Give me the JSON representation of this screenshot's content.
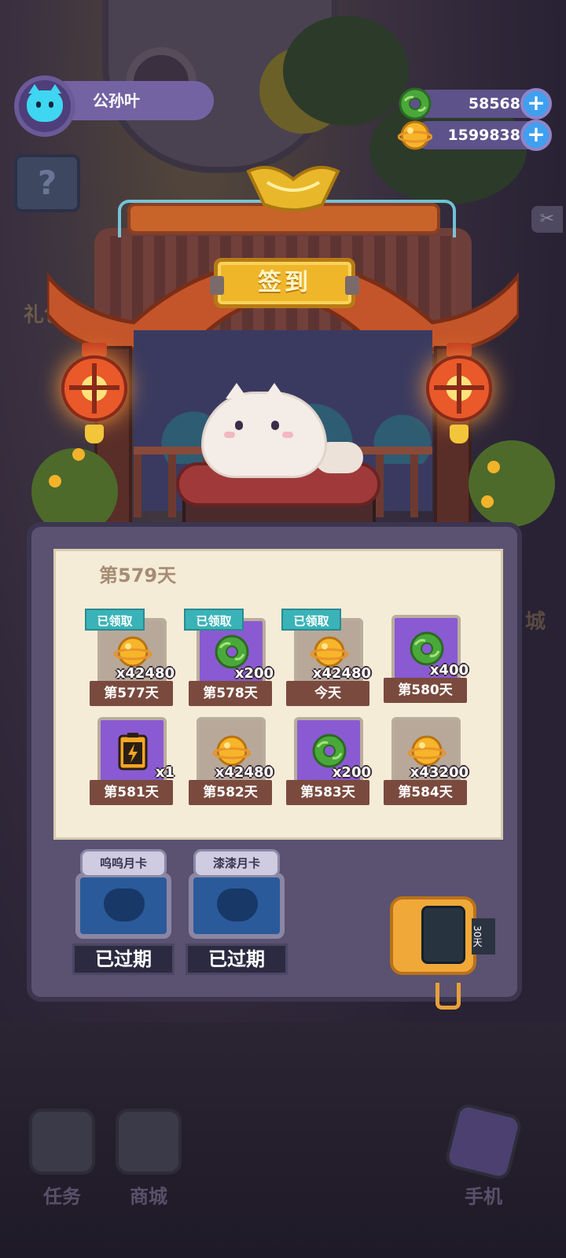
{
  "profile": {
    "name": "公孙叶"
  },
  "currencies": [
    {
      "icon": "green-donut-icon",
      "value": "58568"
    },
    {
      "icon": "gold-coin-icon",
      "value": "1599838"
    }
  ],
  "sign": {
    "label": "签到"
  },
  "calendar": {
    "title": "第579天",
    "claimed_label": "已领取",
    "rewards": [
      {
        "item": "gold-coin-icon",
        "count": "x42480",
        "label": "第577天",
        "claimed": true
      },
      {
        "item": "green-donut-icon",
        "count": "x200",
        "label": "第578天",
        "claimed": true
      },
      {
        "item": "gold-coin-icon",
        "count": "x42480",
        "label": "今天",
        "claimed": true
      },
      {
        "item": "green-donut-icon",
        "count": "x400",
        "label": "第580天",
        "claimed": false
      },
      {
        "item": "battery-icon",
        "count": "x1",
        "label": "第581天",
        "claimed": false
      },
      {
        "item": "gold-coin-icon",
        "count": "x42480",
        "label": "第582天",
        "claimed": false
      },
      {
        "item": "green-donut-icon",
        "count": "x200",
        "label": "第583天",
        "claimed": false
      },
      {
        "item": "gold-coin-icon",
        "count": "x43200",
        "label": "第584天",
        "claimed": false
      }
    ]
  },
  "month_cards": [
    {
      "title": "呜呜月卡",
      "status": "已过期"
    },
    {
      "title": "漆漆月卡",
      "status": "已过期"
    }
  ],
  "background": {
    "gift_label": "礼包",
    "side_label": "城",
    "nav": [
      {
        "label": "任务",
        "icon": "task-book-icon"
      },
      {
        "label": "商城",
        "icon": "shop-icon"
      },
      {
        "label": "手机",
        "icon": "phone-icon"
      }
    ]
  },
  "robot": {
    "tag": "30天"
  },
  "colors": {
    "claimed_badge": "#3ab3b8",
    "tile_label_bg": "#7a4a3e",
    "paper": "#f5ecd8",
    "sign_gold": "#f0b62a"
  }
}
